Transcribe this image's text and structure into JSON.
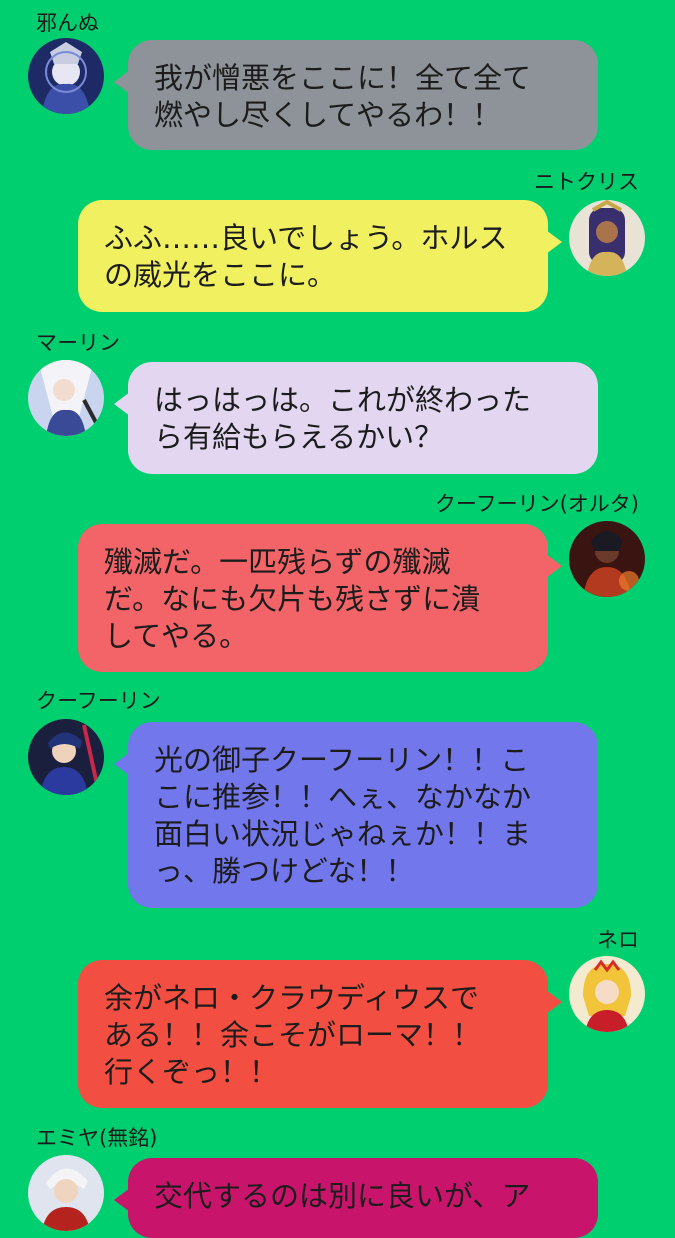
{
  "messages": [
    {
      "side": "left",
      "name": "邪んぬ",
      "text": "我が憎悪をここに！全て全て\n燃やし尽くしてやるわ！！",
      "color": "#8e9399",
      "avatar_icon": "jeanne-alter-avatar-icon"
    },
    {
      "side": "right",
      "name": "ニトクリス",
      "text": "ふふ……良いでしょう。ホルス\nの威光をここに。",
      "color": "#f1f061",
      "avatar_icon": "nitocris-avatar-icon"
    },
    {
      "side": "left",
      "name": "マーリン",
      "text": "はっはっは。これが終わった\nら有給もらえるかい？",
      "color": "#e2d6f1",
      "avatar_icon": "merlin-avatar-icon"
    },
    {
      "side": "right",
      "name": "クーフーリン(オルタ)",
      "text": "殲滅だ。一匹残らずの殲滅\nだ。なにも欠片も残さずに潰\nしてやる。",
      "color": "#f36468",
      "avatar_icon": "cu-alter-avatar-icon"
    },
    {
      "side": "left",
      "name": "クーフーリン",
      "text": "光の御子クーフーリン！！こ\nこに推参！！へぇ、なかなか\n面白い状況じゃねぇか！！ま\nっ、勝つけどな！！",
      "color": "#7277ec",
      "avatar_icon": "cu-chulainn-avatar-icon"
    },
    {
      "side": "right",
      "name": "ネロ",
      "text": "余がネロ・クラウディウスで\nある！！余こそがローマ！！\n行くぞっ！！",
      "color": "#f24f42",
      "avatar_icon": "nero-avatar-icon"
    },
    {
      "side": "left",
      "name": "エミヤ(無銘)",
      "text": "交代するのは別に良いが、ア",
      "color": "#c8156b",
      "avatar_icon": "emiya-alter-avatar-icon"
    }
  ]
}
